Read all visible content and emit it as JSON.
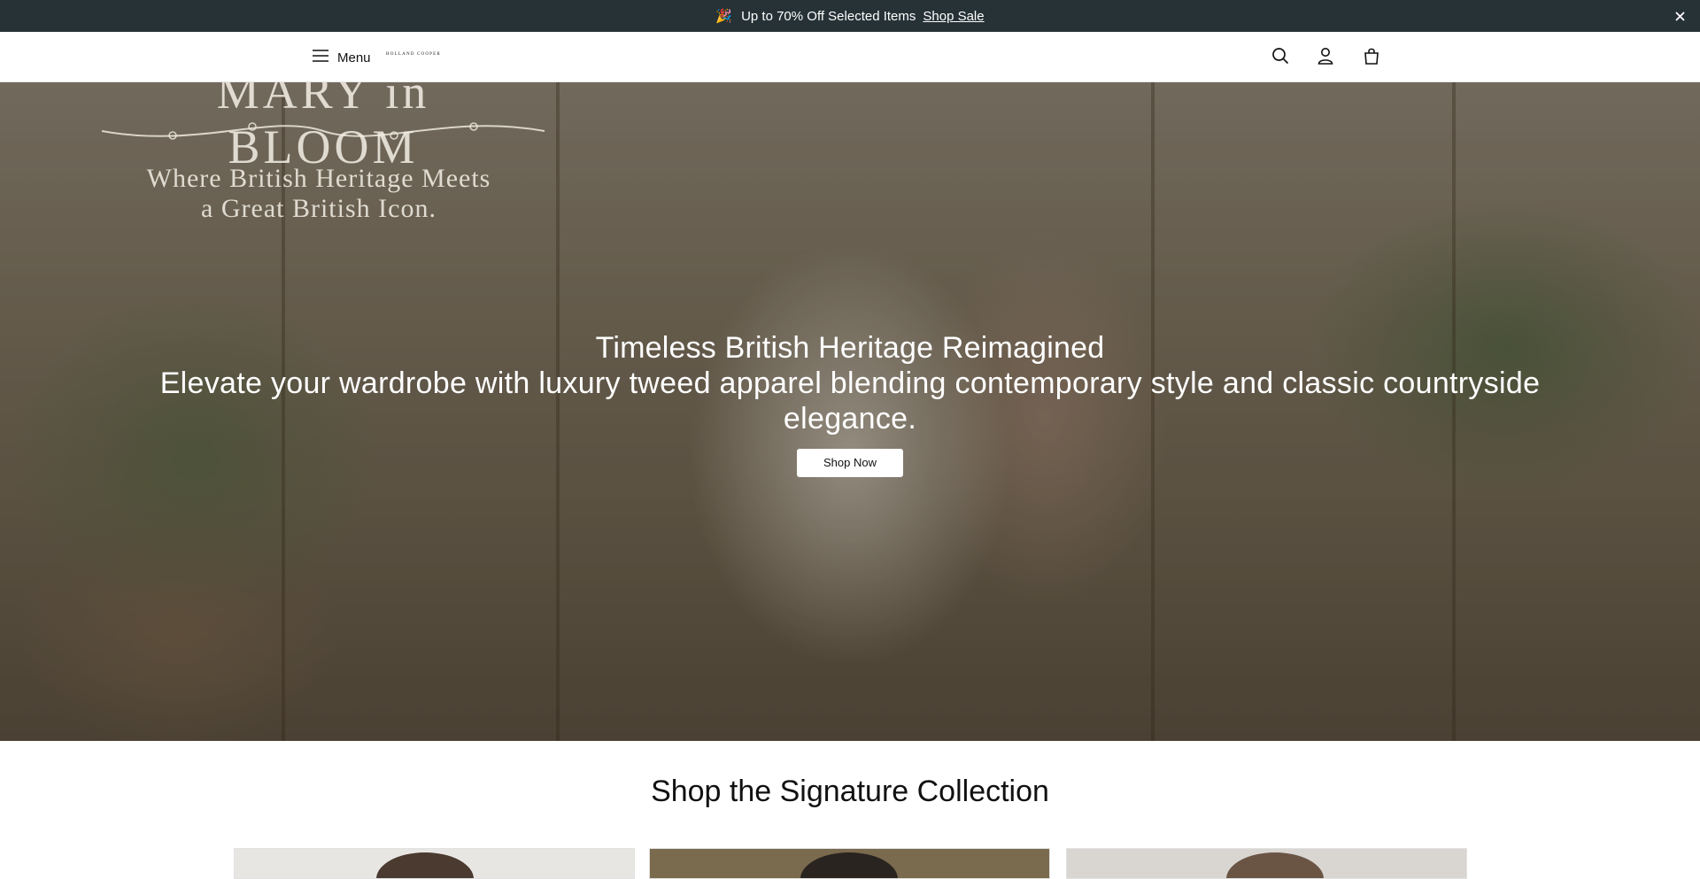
{
  "announcement": {
    "emoji": "🎉",
    "text": "Up to 70% Off Selected Items",
    "link_label": "Shop Sale",
    "close_icon": "close-icon"
  },
  "header": {
    "menu_label": "Menu",
    "logo_text": "HOLLAND COOPER",
    "icons": [
      "hamburger-icon",
      "search-icon",
      "account-icon",
      "bag-icon"
    ]
  },
  "hero": {
    "sign_title": "MARY in BLOOM",
    "sign_line1": "Where British Heritage Meets",
    "sign_line2": "a Great British Icon.",
    "title": "Timeless British Heritage Reimagined",
    "subtitle": "Elevate your wardrobe with luxury tweed apparel blending contemporary style and classic countryside elegance.",
    "cta_label": "Shop Now"
  },
  "collection": {
    "title": "Shop the Signature Collection",
    "tiles": [
      {
        "bg": "#e8e6e3"
      },
      {
        "bg": "#7a6a4e"
      },
      {
        "bg": "#d9d6d2"
      }
    ]
  },
  "colors": {
    "announce_bg": "#263236",
    "header_bg": "#ffffff",
    "cta_bg": "#ffffff"
  }
}
